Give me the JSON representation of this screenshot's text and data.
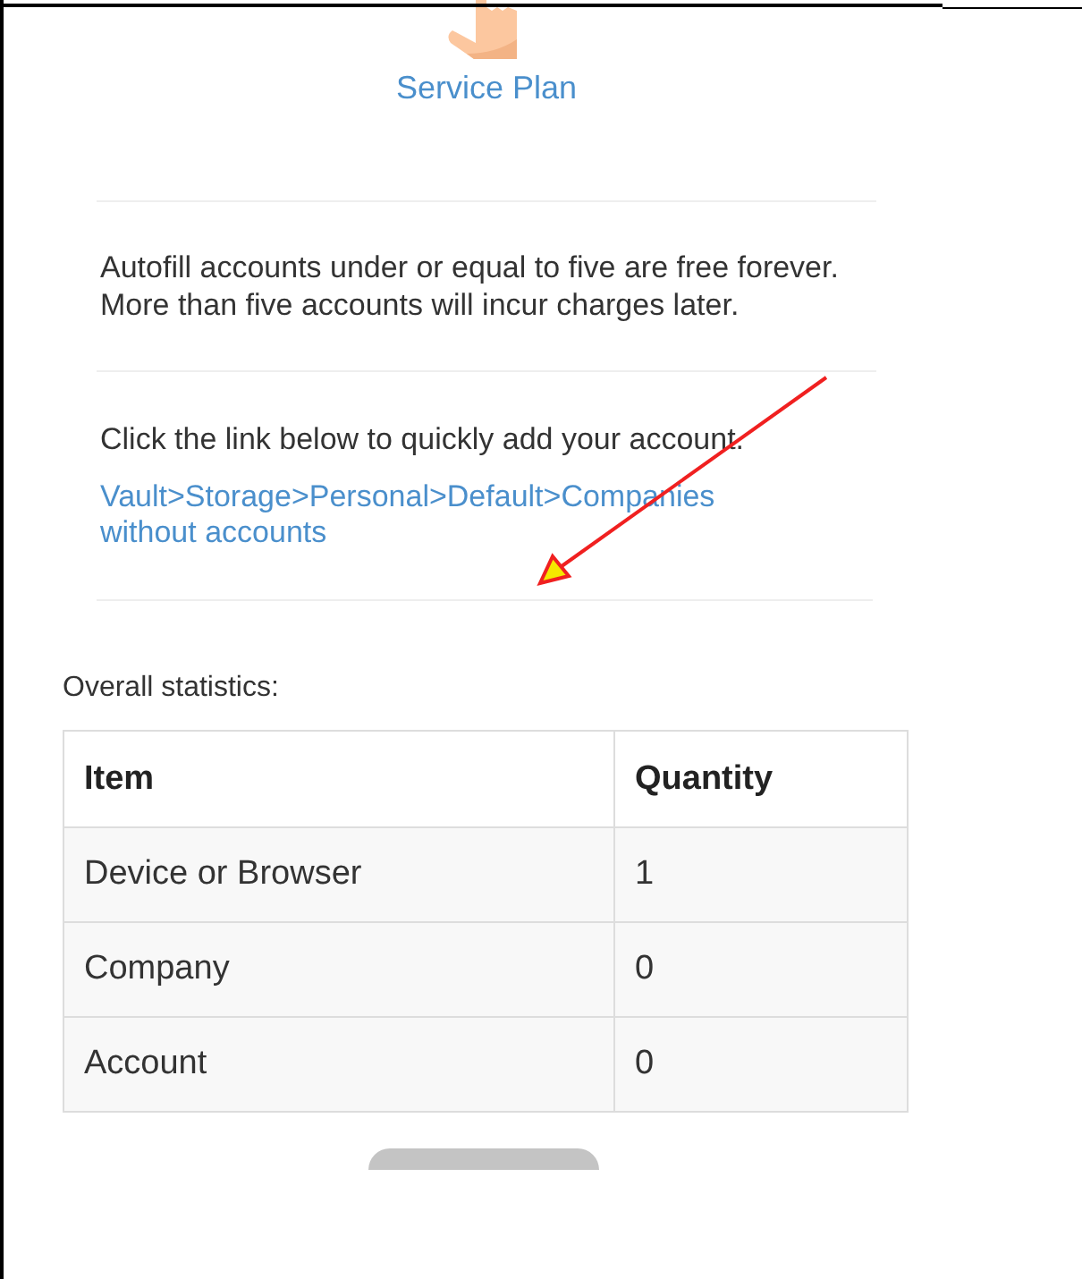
{
  "header": {
    "title": "Service Plan"
  },
  "notice": "Autofill accounts under or equal to five are free forever. More than five accounts will incur charges later.",
  "instruction": "Click the link below to quickly add your account.",
  "link": "Vault>Storage>Personal>Default>Companies without accounts",
  "statistics": {
    "label": "Overall statistics:",
    "columns": [
      "Item",
      "Quantity"
    ],
    "rows": [
      [
        "Device or Browser",
        "1"
      ],
      [
        "Company",
        "0"
      ],
      [
        "Account",
        "0"
      ]
    ]
  }
}
